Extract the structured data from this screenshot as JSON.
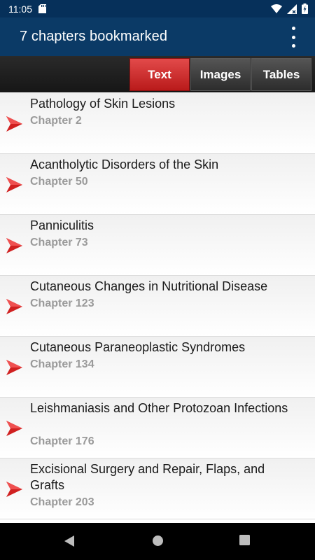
{
  "status_bar": {
    "time": "11:05"
  },
  "app_bar": {
    "title": "7 chapters bookmarked",
    "menu_icon": "overflow-menu-icon"
  },
  "tabs": [
    {
      "label": "Text",
      "active": true
    },
    {
      "label": "Images",
      "active": false
    },
    {
      "label": "Tables",
      "active": false
    }
  ],
  "colors": {
    "header": "#0b3a66",
    "status": "#06305a",
    "accent": "#d02020",
    "subtitle": "#9a9a9a"
  },
  "bookmarks": [
    {
      "title": "Pathology of Skin Lesions",
      "chapter": "Chapter 2"
    },
    {
      "title": "Acantholytic Disorders of the Skin",
      "chapter": "Chapter 50"
    },
    {
      "title": "Panniculitis",
      "chapter": "Chapter 73"
    },
    {
      "title": "Cutaneous Changes in Nutritional Disease",
      "chapter": "Chapter 123"
    },
    {
      "title": "Cutaneous Paraneoplastic Syndromes",
      "chapter": "Chapter 134"
    },
    {
      "title": "Leishmaniasis and Other Protozoan Infections",
      "chapter": "Chapter 176"
    },
    {
      "title": "Excisional Surgery and Repair, Flaps, and Grafts",
      "chapter": "Chapter 203"
    }
  ]
}
